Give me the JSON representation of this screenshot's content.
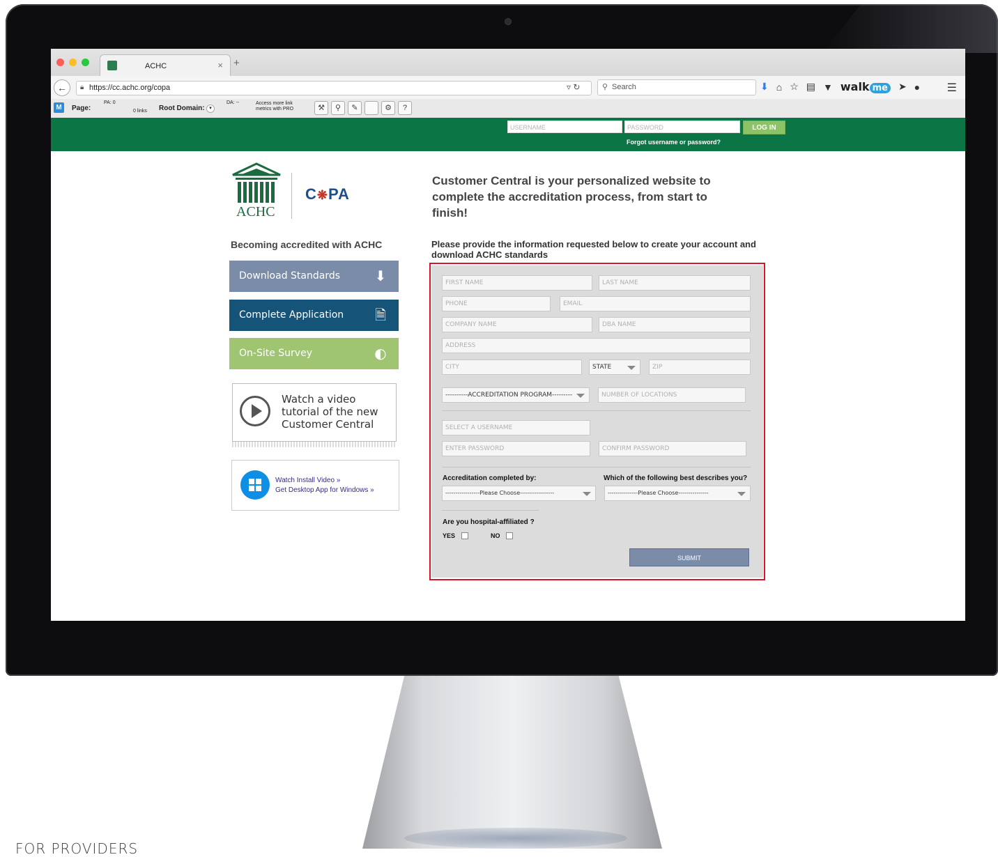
{
  "browser": {
    "tab_title": "ACHC",
    "tab_close": "×",
    "tab_new": "+",
    "url": "https://cc.achc.org/copa",
    "search_placeholder": "Search",
    "walkme_text": "walk",
    "walkme_badge": "me"
  },
  "mozbar": {
    "page_label": "Page:",
    "pa": "PA: 0",
    "links": "0 links",
    "root_domain_label": "Root Domain:",
    "da": "DA: --",
    "access_line1": "Access more link",
    "access_line2": "metrics with PRO"
  },
  "header": {
    "username_placeholder": "USERNAME",
    "password_placeholder": "PASSWORD",
    "login_label": "LOG IN",
    "forgot_link": "Forgot username or password?"
  },
  "logo": {
    "achc": "ACHC",
    "copa_c": "C",
    "copa_pa": "PA"
  },
  "tagline": "Customer Central is your personalized website to complete the accreditation process, from start to finish!",
  "left": {
    "heading": "Becoming accredited with ACHC",
    "download_label": "Download Standards",
    "complete_label": "Complete Application",
    "onsite_label": "On-Site Survey",
    "video_text": "Watch a video tutorial of the new Customer Central",
    "install_video": "Watch Install Video »",
    "desktop_app": "Get Desktop App for Windows »"
  },
  "form": {
    "intro": "Please provide the information requested below to create your account and download ACHC standards",
    "first_name": "FIRST NAME",
    "last_name": "LAST NAME",
    "phone": "PHONE",
    "email": "EMAIL",
    "company": "COMPANY NAME",
    "dba": "DBA NAME",
    "address": "ADDRESS",
    "city": "CITY",
    "state": "STATE",
    "zip": "ZIP",
    "program": "----------ACCREDITATION PROGRAM---------",
    "locations": "NUMBER OF LOCATIONS",
    "username": "SELECT A USERNAME",
    "password": "ENTER PASSWORD",
    "confirm": "CONFIRM PASSWORD",
    "completed_by_label": "Accreditation completed by:",
    "describes_label": "Which of the following best describes you?",
    "please_choose_1": "-----------------Please Choose-----------------",
    "please_choose_2": "---------------Please Choose---------------",
    "hospital_label": "Are you hospital-affiliated ?",
    "yes": "YES",
    "no": "NO",
    "submit": "SUBMIT"
  },
  "footer_text": "FOR PROVIDERS",
  "colors": {
    "header_green": "#0c7545",
    "login_green": "#8cc366",
    "download_blue": "#7b8ca9",
    "complete_navy": "#155478",
    "onsite_green": "#9fc573",
    "form_outline_red": "#d7142a"
  }
}
